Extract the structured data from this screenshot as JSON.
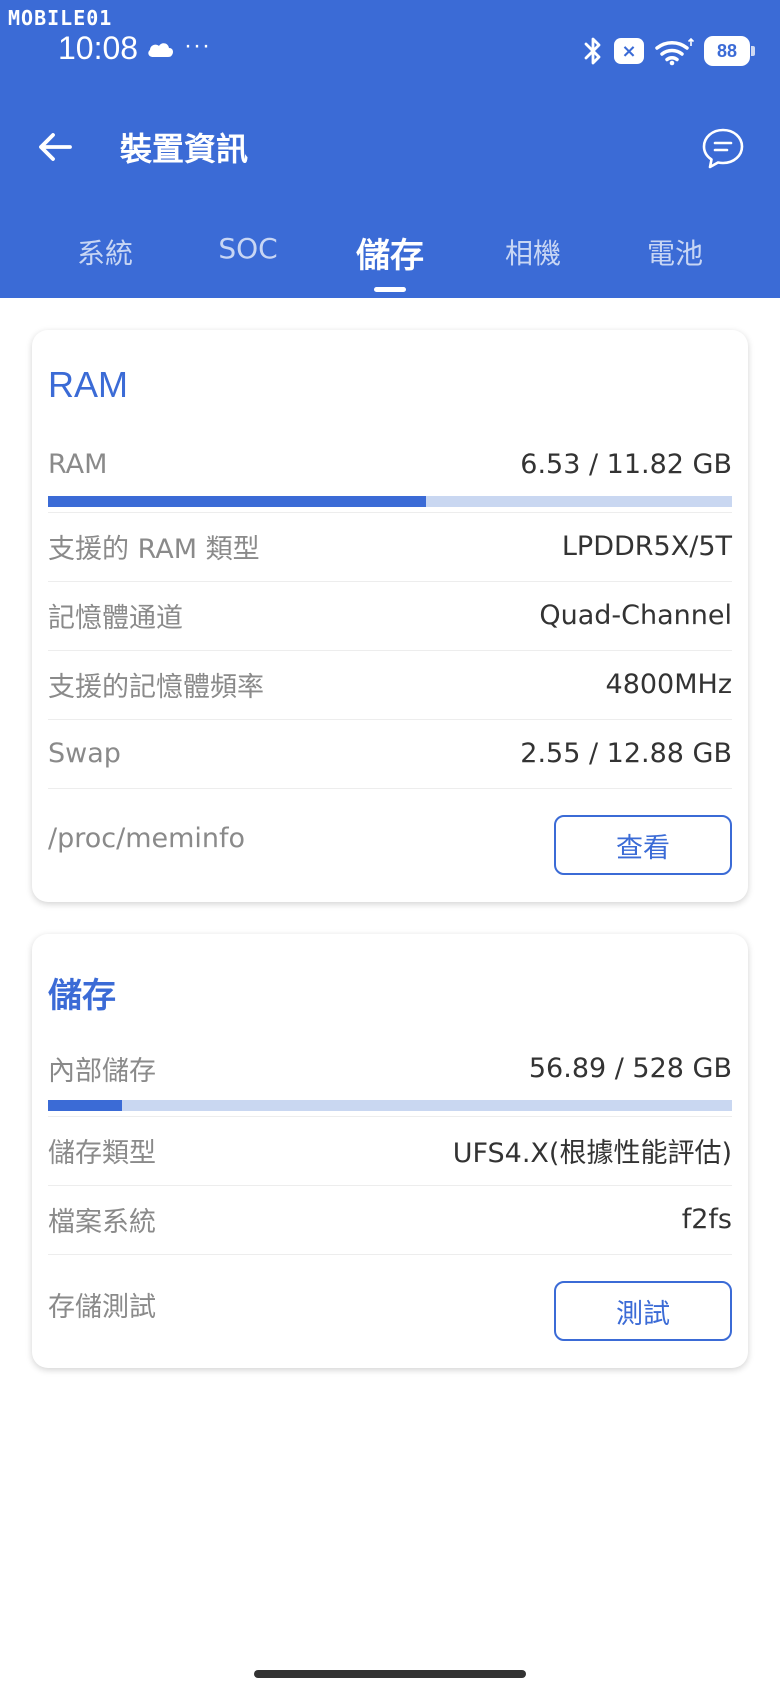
{
  "watermark": "MOBILE01",
  "status_bar": {
    "time": "10:08",
    "more": "···",
    "mute_symbol": "×",
    "battery": "88"
  },
  "header": {
    "title": "裝置資訊",
    "tabs": [
      {
        "label": "系統"
      },
      {
        "label": "SOC"
      },
      {
        "label": "儲存"
      },
      {
        "label": "相機"
      },
      {
        "label": "電池"
      }
    ],
    "active_tab": "儲存"
  },
  "colors": {
    "accent": "#3B6BD6",
    "track": "#C9D7F1"
  },
  "ram_card": {
    "title": "RAM",
    "ram_label": "RAM",
    "ram_value": "6.53 / 11.82 GB",
    "ram_used_fraction": 0.5525,
    "rows": [
      {
        "label": "支援的 RAM 類型",
        "value": "LPDDR5X/5T"
      },
      {
        "label": "記憶體通道",
        "value": "Quad-Channel"
      },
      {
        "label": "支援的記憶體頻率",
        "value": "4800MHz"
      },
      {
        "label": "Swap",
        "value": "2.55 / 12.88 GB"
      }
    ],
    "meminfo_label": "/proc/meminfo",
    "meminfo_button": "查看"
  },
  "storage_card": {
    "title": "儲存",
    "internal_label": "內部儲存",
    "internal_value": "56.89 / 528 GB",
    "internal_used_fraction": 0.1077,
    "rows": [
      {
        "label": "儲存類型",
        "value": "UFS4.X(根據性能評估)"
      },
      {
        "label": "檔案系統",
        "value": "f2fs"
      }
    ],
    "test_label": "存儲測試",
    "test_button": "測試"
  }
}
